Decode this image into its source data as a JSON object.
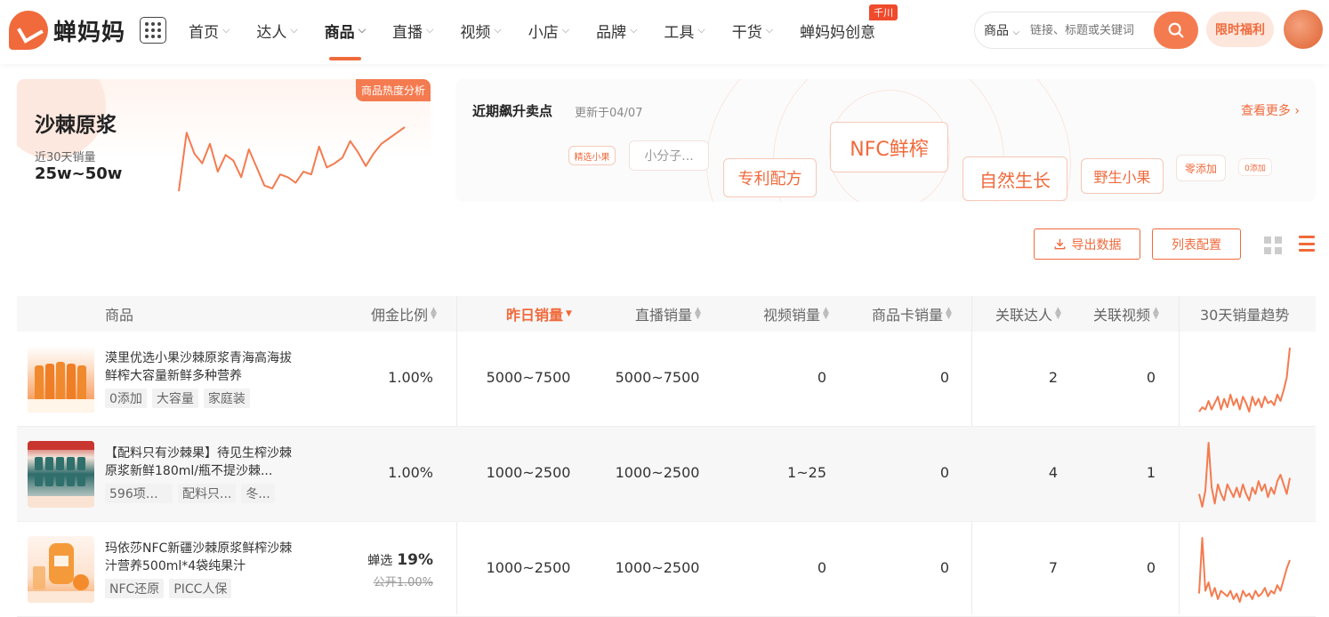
{
  "brand": {
    "name": "蝉妈妈",
    "accent": "#f06a3c"
  },
  "nav": {
    "items": [
      {
        "label": "首页",
        "chevron": true,
        "active": false
      },
      {
        "label": "达人",
        "chevron": true,
        "active": false
      },
      {
        "label": "商品",
        "chevron": true,
        "active": true
      },
      {
        "label": "直播",
        "chevron": true,
        "active": false
      },
      {
        "label": "视频",
        "chevron": true,
        "active": false
      },
      {
        "label": "小店",
        "chevron": true,
        "active": false
      },
      {
        "label": "品牌",
        "chevron": true,
        "active": false
      },
      {
        "label": "工具",
        "chevron": true,
        "active": false
      },
      {
        "label": "干货",
        "chevron": true,
        "active": false
      },
      {
        "label": "蝉妈妈创意",
        "chevron": false,
        "active": false,
        "badge": "千川"
      }
    ]
  },
  "search": {
    "type": "商品",
    "placeholder": "链接、标题或关键词"
  },
  "promo": {
    "label": "限时福利"
  },
  "summary": {
    "tag": "商品热度分析",
    "title": "沙棘原浆",
    "label": "近30天销量",
    "value": "25w~50w",
    "trend": [
      72,
      30,
      45,
      52,
      38,
      58,
      46,
      50,
      62,
      42,
      55,
      68,
      70,
      60,
      62,
      66,
      58,
      60,
      40,
      55,
      52,
      48,
      36,
      44,
      54,
      45,
      38,
      34,
      30,
      26
    ]
  },
  "selling_points": {
    "title": "近期飙升卖点",
    "updated": "更新于04/07",
    "more": "查看更多",
    "chips": [
      {
        "label": "精选小果"
      },
      {
        "label": "小分子..."
      },
      {
        "label": "专利配方"
      },
      {
        "label": "NFC鲜榨"
      },
      {
        "label": "自然生长"
      },
      {
        "label": "野生小果"
      },
      {
        "label": "零添加"
      },
      {
        "label": "0添加"
      }
    ]
  },
  "toolbar": {
    "export_label": "导出数据",
    "config_label": "列表配置"
  },
  "table": {
    "headers": {
      "product": "商品",
      "commission": "佣金比例",
      "yesterday": "昨日销量",
      "live": "直播销量",
      "video": "视频销量",
      "card": "商品卡销量",
      "influencers": "关联达人",
      "videos": "关联视频",
      "trend": "30天销量趋势"
    },
    "rows": [
      {
        "name": "漠里优选小果沙棘原浆青海高海拔鲜榨大容量新鲜多种营养",
        "tags": [
          "0添加",
          "大容量",
          "家庭装"
        ],
        "commission": "1.00%",
        "yesterday": "5000~7500",
        "live": "5000~7500",
        "video": "0",
        "card": "0",
        "influencers": "2",
        "videos": "0",
        "trend": [
          62,
          58,
          60,
          52,
          60,
          54,
          48,
          60,
          50,
          58,
          46,
          56,
          50,
          60,
          48,
          54,
          62,
          48,
          56,
          50,
          58,
          48,
          54,
          52,
          56,
          46,
          52,
          42,
          30,
          2
        ]
      },
      {
        "name": "【配料只有沙棘果】待见生榨沙棘原浆新鲜180ml/瓶不提沙棘...",
        "tags": [
          "596项农...",
          "配料只...",
          "冬..."
        ],
        "commission": "1.00%",
        "yesterday": "1000~2500",
        "live": "1000~2500",
        "video": "1~25",
        "card": "0",
        "influencers": "4",
        "videos": "1",
        "trend": [
          52,
          60,
          50,
          20,
          48,
          58,
          46,
          52,
          56,
          46,
          50,
          54,
          48,
          54,
          46,
          52,
          56,
          48,
          52,
          44,
          50,
          46,
          54,
          48,
          52,
          44,
          40,
          46,
          52,
          42
        ]
      },
      {
        "name": "玛依莎NFC新疆沙棘原浆鲜榨沙棘汁营养500ml*4袋纯果汁",
        "tags": [
          "NFC还原",
          "PICC人保"
        ],
        "commission_selected": "19%",
        "commission_selected_prefix": "蝉选",
        "commission_public": "公开1.00%",
        "yesterday": "1000~2500",
        "live": "1000~2500",
        "video": "0",
        "card": "0",
        "influencers": "7",
        "videos": "0",
        "trend": [
          60,
          20,
          58,
          52,
          62,
          56,
          64,
          58,
          60,
          62,
          58,
          64,
          60,
          66,
          58,
          62,
          60,
          64,
          58,
          62,
          60,
          56,
          62,
          58,
          60,
          54,
          58,
          50,
          42,
          36
        ]
      }
    ]
  }
}
